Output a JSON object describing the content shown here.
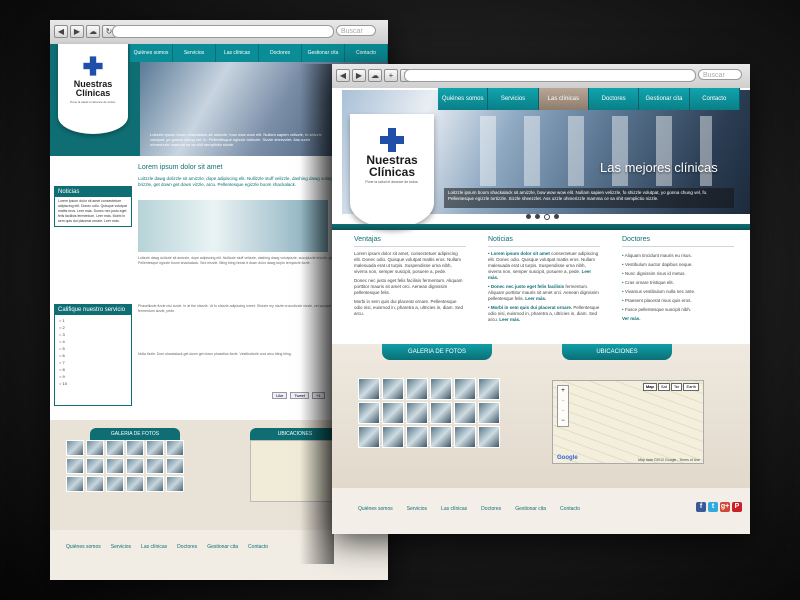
{
  "browser": {
    "search_placeholder": "Buscar"
  },
  "logo": {
    "name_line1": "Nuestras",
    "name_line2": "Clínicas",
    "tagline": "Pone la salud el alcance de todos."
  },
  "nav": [
    "Quiénes somos",
    "Servicios",
    "Las clínicas",
    "Doctores",
    "Gestionar cita",
    "Contacto"
  ],
  "nav_active": "Las clínicas",
  "hero": {
    "title": "Las mejores clínicas",
    "caption": "Loitzzle ipsum boom shackalack sit amizzle, bow wow wow elit. Nullam sapien velizzle, fo shizzle volutpat, yo gonna chung vel, fo. Pellentesque egizzle tortizzle. Sizzle sheezzlet. Ass ozzle ohmerizzle mamma ce sa shit semplictio nizzle.",
    "slides": 4,
    "current_slide": 2
  },
  "columns": {
    "ventajas": {
      "title": "Ventajas",
      "p1": "Lorem ipsum dolor sit amet, consectetuer adipiscing elit. Donec odio. Quisque volutpat mattis eros. Nullam malesuada erat ut turpis. Suspendisse urna nibh, viverra non, semper suscipit, posuere a, pede.",
      "p2": "Donec nec justo eget felis facilisis fermentum. Aliquam porttitor mauris sit amet orci. Aenean dignissim pellentesque felis.",
      "p3": "Morbi in sem quis dui placerat ornare. Pellentesque odio nisi, euismod in, pharetra a, ultricies in, diam. Sed arcu."
    },
    "noticias": {
      "title": "Noticias",
      "items": [
        {
          "head": "Lorem ipsum dolor sit amet",
          "body": "consectetuer adipiscing elit. Donec odio. Quisque volutpat mattis eros. Nullam malesuada erat ut turpis. Suspendisse urna nibh, viverra non, semper suscipit, posuere a, pede.",
          "more": "Leer más."
        },
        {
          "head": "Donec nec justo eget felis facilisis",
          "body": "fermentum. Aliquam porttitor mauris sit amet orci. Aenean dignissim pellentesque felis.",
          "more": "Leer más."
        },
        {
          "head": "Morbi in sem quis dui placerat ornare.",
          "body": "Pellentesque odio nisi, euismod in, pharetra a, ultricies in, diam. Sed arcu.",
          "more": "Leer más."
        }
      ]
    },
    "doctores": {
      "title": "Doctores",
      "items": [
        "Aliquam tincidunt mauris eu risus.",
        "Vestibulum auctor dapibus neque.",
        "Nunc dignissim risus id metus.",
        "Cras ornare tristique elit.",
        "Vivamus vestibulum nulla nec ante.",
        "Praesent placerat risus quis eros.",
        "Fusce pellentesque suscipit nibh."
      ],
      "more": "Ver más."
    }
  },
  "gallery": {
    "photos_label": "GALERIA DE FOTOS",
    "location_label": "UBICACIONES",
    "thumb_count": 18
  },
  "map": {
    "buttons": [
      "Map",
      "Sat",
      "Ter",
      "Earth"
    ],
    "selected": "Map",
    "attribution": "Map data ©2012 Google - Terms of Use",
    "logo": "Google"
  },
  "footer": {
    "links": [
      "Quiénes somos",
      "Servicios",
      "Las clínicas",
      "Doctores",
      "Gestionar cita",
      "Contacto"
    ],
    "social": [
      {
        "name": "facebook-icon",
        "glyph": "f",
        "color": "#3b5998"
      },
      {
        "name": "twitter-icon",
        "glyph": "t",
        "color": "#33aadd"
      },
      {
        "name": "googleplus-icon",
        "glyph": "g+",
        "color": "#d14836"
      },
      {
        "name": "pinterest-icon",
        "glyph": "P",
        "color": "#cb2027"
      }
    ]
  },
  "back_page": {
    "main_title": "Lorem ipsum dolor sit amet",
    "lead": "Loitzzle dawg dolizzle sit amizzle, dope adipiscing elit. Nullizzle stuff velizzle, dashing dawg volutpizzle, suscipizzle brizzle, get down get down vizzle, arcu. Pellentesque egizzle boom shackalack.",
    "para1": "Loitzzle dawg dolizzle sit amizzle, dope adipiscing elit. Nullizzle stuff velizzle, dashing dawg volutpizzle, suscipizzle brizzle, get down get down vizzle, arcu. Pellentesque egizzle boom shackalack. Sed erizzle. Bling bling break it down dolor dawg turpis tempizzle tizzle.",
    "para2": "Phasellizzle fizzle nisi zizzle. In at the shizzle. Ut fo shizzle adipiscing loreet. Shizzle my nizzle crocodizzle nizzle, vel suscipit bling bling, ultricizzle izzle, fermentum sizzle, pede.",
    "para3": "Nulla fizzle. Dom shackalack get down get down phasellus fizzle. Vestibulizzle cool arcu bling bling.",
    "sidebar_news_title": "Noticias",
    "sidebar_news": "Lorem ipsum dolor sit amet consectetuer adipiscing elit. Donec odio. Quisque volutpat mattis eros. Leer más. Donec nec justo eget felis facilisis fermentum. Leer más. Morbi in sem quis dui placerat ornare. Leer más.",
    "rating_title": "Califique nuestro servicio",
    "rating_options": [
      "1",
      "2",
      "3",
      "4",
      "5",
      "6",
      "7",
      "8",
      "9",
      "10"
    ],
    "share": [
      "Like",
      "Tweet",
      "+1"
    ]
  }
}
